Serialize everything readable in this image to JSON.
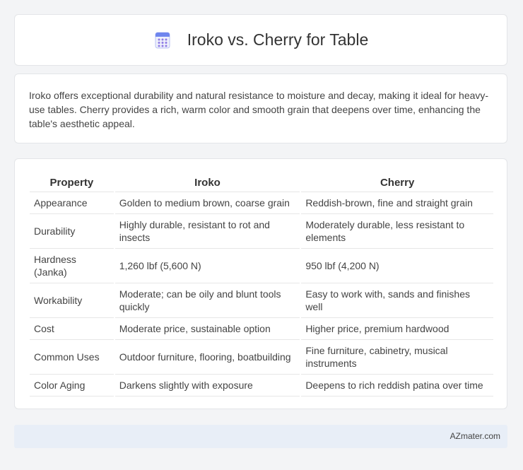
{
  "header": {
    "title": "Iroko vs. Cherry for Table",
    "icon": "calculator-icon"
  },
  "description": "Iroko offers exceptional durability and natural resistance to moisture and decay, making it ideal for heavy-use tables. Cherry provides a rich, warm color and smooth grain that deepens over time, enhancing the table's aesthetic appeal.",
  "table": {
    "headers": [
      "Property",
      "Iroko",
      "Cherry"
    ],
    "rows": [
      [
        "Appearance",
        "Golden to medium brown, coarse grain",
        "Reddish-brown, fine and straight grain"
      ],
      [
        "Durability",
        "Highly durable, resistant to rot and insects",
        "Moderately durable, less resistant to elements"
      ],
      [
        "Hardness (Janka)",
        "1,260 lbf (5,600 N)",
        "950 lbf (4,200 N)"
      ],
      [
        "Workability",
        "Moderate; can be oily and blunt tools quickly",
        "Easy to work with, sands and finishes well"
      ],
      [
        "Cost",
        "Moderate price, sustainable option",
        "Higher price, premium hardwood"
      ],
      [
        "Common Uses",
        "Outdoor furniture, flooring, boatbuilding",
        "Fine furniture, cabinetry, musical instruments"
      ],
      [
        "Color Aging",
        "Darkens slightly with exposure",
        "Deepens to rich reddish patina over time"
      ]
    ]
  },
  "footer": {
    "brand": "AZmater.com"
  },
  "colors": {
    "footer_bg": "#e8eef7",
    "page_bg": "#f3f4f6",
    "icon_accent": "#7b8cf0"
  }
}
